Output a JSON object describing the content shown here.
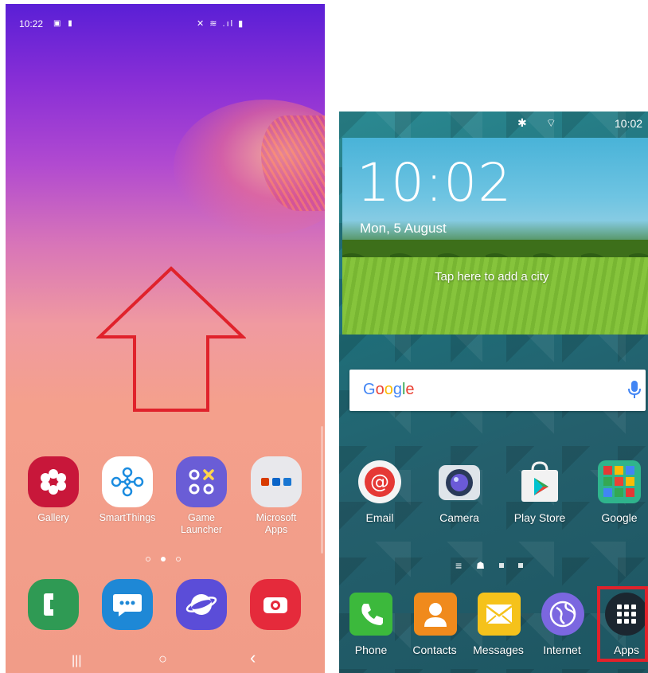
{
  "left_phone": {
    "status": {
      "time": "10:22",
      "left_icons": "▣ ▮",
      "right_icons": "✕ ≋ .ıl ▮"
    },
    "apps": [
      {
        "label": "Gallery",
        "icon": "gallery-icon",
        "color": "#c8173a"
      },
      {
        "label": "SmartThings",
        "icon": "smartthings-icon",
        "color": "#ffffff"
      },
      {
        "label": "Game\nLauncher",
        "icon": "game-launcher-icon",
        "color": "#6a5dd6"
      },
      {
        "label": "Microsoft\nApps",
        "icon": "microsoft-apps-folder-icon",
        "color": "#e8e8ec"
      }
    ],
    "dock": [
      {
        "icon": "phone-icon",
        "color": "#2f9a54"
      },
      {
        "icon": "messages-icon",
        "color": "#1e88d6"
      },
      {
        "icon": "internet-icon",
        "color": "#5b4dd8"
      },
      {
        "icon": "camera-icon",
        "color": "#e52a3b"
      }
    ],
    "nav": {
      "recents": "|||",
      "home": "○",
      "back": "‹"
    }
  },
  "right_phone": {
    "status": {
      "time": "10:02",
      "icons": "✱ ⌔"
    },
    "widget": {
      "time": "10:02",
      "date": "Mon, 5 August",
      "city_hint": "Tap here to add a city"
    },
    "search": {
      "logo": "Google"
    },
    "apps": [
      {
        "label": "Email",
        "icon": "email-icon"
      },
      {
        "label": "Camera",
        "icon": "camera-icon"
      },
      {
        "label": "Play Store",
        "icon": "play-store-icon"
      },
      {
        "label": "Google",
        "icon": "google-folder-icon"
      }
    ],
    "dock": [
      {
        "label": "Phone",
        "icon": "phone-icon",
        "color": "#3cb93c"
      },
      {
        "label": "Contacts",
        "icon": "contacts-icon",
        "color": "#f08a1c"
      },
      {
        "label": "Messages",
        "icon": "messages-icon",
        "color": "#f5c21b"
      },
      {
        "label": "Internet",
        "icon": "internet-icon",
        "color": "#7b67e0"
      },
      {
        "label": "Apps",
        "icon": "apps-grid-icon",
        "color": "#1b2630"
      }
    ]
  },
  "annotations": {
    "swipe_arrow_color": "#e0222b",
    "highlight_color": "#e0222b"
  }
}
